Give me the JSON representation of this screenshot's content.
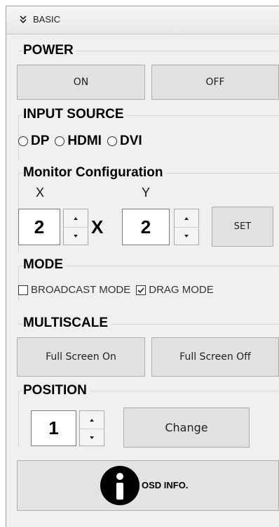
{
  "header": {
    "title": "BASIC",
    "icon": "double-chevron-down-icon"
  },
  "power": {
    "title": "POWER",
    "on_label": "ON",
    "off_label": "OFF"
  },
  "input_source": {
    "title": "INPUT SOURCE",
    "options": [
      "DP",
      "HDMI",
      "DVI"
    ]
  },
  "monitor_config": {
    "title": "Monitor Configuration",
    "x_label": "X",
    "y_label": "Y",
    "x_value": "2",
    "y_value": "2",
    "separator": "X",
    "set_label": "SET"
  },
  "mode": {
    "title": "MODE",
    "broadcast_label": "BROADCAST MODE",
    "broadcast_checked": false,
    "drag_label": "DRAG MODE",
    "drag_checked": true
  },
  "multiscale": {
    "title": "MULTISCALE",
    "on_label": "Full Screen On",
    "off_label": "Full Screen Off"
  },
  "position": {
    "title": "POSITION",
    "value": "1",
    "change_label": "Change"
  },
  "osd": {
    "label": "OSD INFO.",
    "icon": "info-icon"
  }
}
